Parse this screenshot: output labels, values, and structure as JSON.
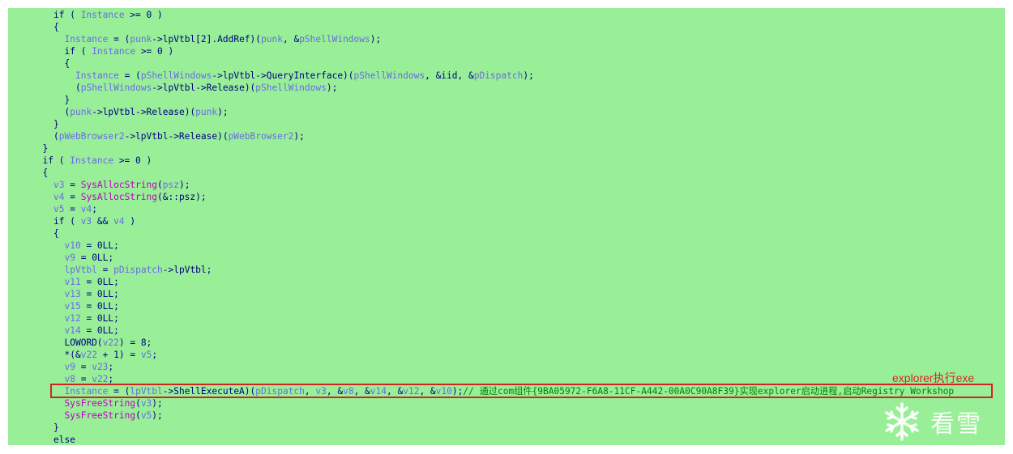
{
  "lines": [
    {
      "indent": 6,
      "tokens": [
        [
          "kw",
          "if ( "
        ],
        [
          "local",
          "Instance"
        ],
        [
          "kw",
          " >= 0 )"
        ]
      ]
    },
    {
      "indent": 6,
      "tokens": [
        [
          "kw",
          "{"
        ]
      ]
    },
    {
      "indent": 8,
      "tokens": [
        [
          "local",
          "Instance"
        ],
        [
          "kw",
          " = ("
        ],
        [
          "local",
          "punk"
        ],
        [
          "kw",
          "->lpVtbl[2].AddRef)("
        ],
        [
          "local",
          "punk"
        ],
        [
          "kw",
          ", &"
        ],
        [
          "local",
          "pShellWindows"
        ],
        [
          "kw",
          ");"
        ]
      ]
    },
    {
      "indent": 8,
      "tokens": [
        [
          "kw",
          "if ( "
        ],
        [
          "local",
          "Instance"
        ],
        [
          "kw",
          " >= 0 )"
        ]
      ]
    },
    {
      "indent": 8,
      "tokens": [
        [
          "kw",
          "{"
        ]
      ]
    },
    {
      "indent": 10,
      "tokens": [
        [
          "local",
          "Instance"
        ],
        [
          "kw",
          " = ("
        ],
        [
          "local",
          "pShellWindows"
        ],
        [
          "kw",
          "->lpVtbl->QueryInterface)("
        ],
        [
          "local",
          "pShellWindows"
        ],
        [
          "kw",
          ", &iid, &"
        ],
        [
          "local",
          "pDispatch"
        ],
        [
          "kw",
          ");"
        ]
      ]
    },
    {
      "indent": 10,
      "tokens": [
        [
          "kw",
          "("
        ],
        [
          "local",
          "pShellWindows"
        ],
        [
          "kw",
          "->lpVtbl->Release)("
        ],
        [
          "local",
          "pShellWindows"
        ],
        [
          "kw",
          ");"
        ]
      ]
    },
    {
      "indent": 8,
      "tokens": [
        [
          "kw",
          "}"
        ]
      ]
    },
    {
      "indent": 8,
      "tokens": [
        [
          "kw",
          "("
        ],
        [
          "local",
          "punk"
        ],
        [
          "kw",
          "->lpVtbl->Release)("
        ],
        [
          "local",
          "punk"
        ],
        [
          "kw",
          ");"
        ]
      ]
    },
    {
      "indent": 6,
      "tokens": [
        [
          "kw",
          "}"
        ]
      ]
    },
    {
      "indent": 6,
      "tokens": [
        [
          "kw",
          "("
        ],
        [
          "local",
          "pWebBrowser2"
        ],
        [
          "kw",
          "->lpVtbl->Release)("
        ],
        [
          "local",
          "pWebBrowser2"
        ],
        [
          "kw",
          ");"
        ]
      ]
    },
    {
      "indent": 4,
      "tokens": [
        [
          "kw",
          "}"
        ]
      ]
    },
    {
      "indent": 4,
      "tokens": [
        [
          "kw",
          "if ( "
        ],
        [
          "local",
          "Instance"
        ],
        [
          "kw",
          " >= 0 )"
        ]
      ]
    },
    {
      "indent": 4,
      "tokens": [
        [
          "kw",
          "{"
        ]
      ]
    },
    {
      "indent": 6,
      "tokens": [
        [
          "local",
          "v3"
        ],
        [
          "kw",
          " = "
        ],
        [
          "func",
          "SysAllocString"
        ],
        [
          "kw",
          "("
        ],
        [
          "local",
          "psz"
        ],
        [
          "kw",
          ");"
        ]
      ]
    },
    {
      "indent": 6,
      "tokens": [
        [
          "local",
          "v4"
        ],
        [
          "kw",
          " = "
        ],
        [
          "func",
          "SysAllocString"
        ],
        [
          "kw",
          "(&::psz);"
        ]
      ]
    },
    {
      "indent": 6,
      "tokens": [
        [
          "local",
          "v5"
        ],
        [
          "kw",
          " = "
        ],
        [
          "local",
          "v4"
        ],
        [
          "kw",
          ";"
        ]
      ]
    },
    {
      "indent": 6,
      "tokens": [
        [
          "kw",
          "if ( "
        ],
        [
          "local",
          "v3"
        ],
        [
          "kw",
          " && "
        ],
        [
          "local",
          "v4"
        ],
        [
          "kw",
          " )"
        ]
      ]
    },
    {
      "indent": 6,
      "tokens": [
        [
          "kw",
          "{"
        ]
      ]
    },
    {
      "indent": 8,
      "tokens": [
        [
          "local",
          "v10"
        ],
        [
          "kw",
          " = 0LL;"
        ]
      ]
    },
    {
      "indent": 8,
      "tokens": [
        [
          "local",
          "v9"
        ],
        [
          "kw",
          " = 0LL;"
        ]
      ]
    },
    {
      "indent": 8,
      "tokens": [
        [
          "local",
          "lpVtbl"
        ],
        [
          "kw",
          " = "
        ],
        [
          "local",
          "pDispatch"
        ],
        [
          "kw",
          "->lpVtbl;"
        ]
      ]
    },
    {
      "indent": 8,
      "tokens": [
        [
          "local",
          "v11"
        ],
        [
          "kw",
          " = 0LL;"
        ]
      ]
    },
    {
      "indent": 8,
      "tokens": [
        [
          "local",
          "v13"
        ],
        [
          "kw",
          " = 0LL;"
        ]
      ]
    },
    {
      "indent": 8,
      "tokens": [
        [
          "local",
          "v15"
        ],
        [
          "kw",
          " = 0LL;"
        ]
      ]
    },
    {
      "indent": 8,
      "tokens": [
        [
          "local",
          "v12"
        ],
        [
          "kw",
          " = 0LL;"
        ]
      ]
    },
    {
      "indent": 8,
      "tokens": [
        [
          "local",
          "v14"
        ],
        [
          "kw",
          " = 0LL;"
        ]
      ]
    },
    {
      "indent": 8,
      "tokens": [
        [
          "kw",
          "LOWORD("
        ],
        [
          "local",
          "v22"
        ],
        [
          "kw",
          ") = 8;"
        ]
      ]
    },
    {
      "indent": 8,
      "tokens": [
        [
          "kw",
          "*(&"
        ],
        [
          "local",
          "v22"
        ],
        [
          "kw",
          " + 1) = "
        ],
        [
          "local",
          "v5"
        ],
        [
          "kw",
          ";"
        ]
      ]
    },
    {
      "indent": 8,
      "tokens": [
        [
          "local",
          "v9"
        ],
        [
          "kw",
          " = "
        ],
        [
          "local",
          "v23"
        ],
        [
          "kw",
          ";"
        ]
      ]
    },
    {
      "indent": 8,
      "tokens": [
        [
          "local",
          "v8"
        ],
        [
          "kw",
          " = "
        ],
        [
          "local",
          "v22"
        ],
        [
          "kw",
          ";"
        ]
      ]
    },
    {
      "indent": 8,
      "tokens": [
        [
          "local",
          "Instance"
        ],
        [
          "kw",
          " = ("
        ],
        [
          "local",
          "lpVtbl"
        ],
        [
          "kw",
          "->ShellExecuteA)("
        ],
        [
          "local",
          "pDispatch"
        ],
        [
          "kw",
          ", "
        ],
        [
          "local",
          "v3"
        ],
        [
          "kw",
          ", &"
        ],
        [
          "local",
          "v8"
        ],
        [
          "kw",
          ", &"
        ],
        [
          "local",
          "v14"
        ],
        [
          "kw",
          ", &"
        ],
        [
          "local",
          "v12"
        ],
        [
          "kw",
          ", &"
        ],
        [
          "local",
          "v10"
        ],
        [
          "kw",
          ");"
        ],
        [
          "comment",
          "// 通过com组件{9BA05972-F6A8-11CF-A442-00A0C90A8F39}实现explorer启动进程,启动Registry Workshop"
        ]
      ]
    },
    {
      "indent": 8,
      "tokens": [
        [
          "func",
          "SysFreeString"
        ],
        [
          "kw",
          "("
        ],
        [
          "local",
          "v3"
        ],
        [
          "kw",
          ");"
        ]
      ]
    },
    {
      "indent": 8,
      "tokens": [
        [
          "func",
          "SysFreeString"
        ],
        [
          "kw",
          "("
        ],
        [
          "local",
          "v5"
        ],
        [
          "kw",
          ");"
        ]
      ]
    },
    {
      "indent": 6,
      "tokens": [
        [
          "kw",
          "}"
        ]
      ]
    },
    {
      "indent": 6,
      "tokens": [
        [
          "kw",
          "else"
        ]
      ]
    }
  ],
  "annotation": "explorer执行exe",
  "watermark": {
    "text": "看雪",
    "icon": "snowflake-icon"
  },
  "colors": {
    "background": "#98ef98",
    "keyword": "#000080",
    "local": "#6a6ae8",
    "function": "#c000c0",
    "comment": "#007f00",
    "highlight": "#d42222"
  }
}
